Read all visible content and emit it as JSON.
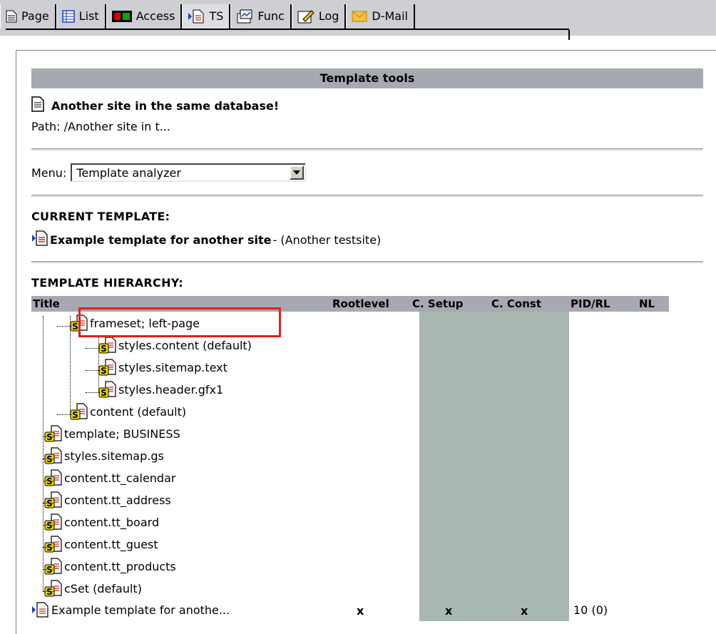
{
  "tabs": [
    {
      "label": "Page",
      "icon": "page-icon"
    },
    {
      "label": "List",
      "icon": "list-icon"
    },
    {
      "label": "Access",
      "icon": "access-icon"
    },
    {
      "label": "TS",
      "icon": "ts-template-icon"
    },
    {
      "label": "Func",
      "icon": "func-icon"
    },
    {
      "label": "Log",
      "icon": "log-icon"
    },
    {
      "label": "D-Mail",
      "icon": "mail-icon"
    }
  ],
  "header": {
    "title": "Template tools"
  },
  "page": {
    "title": "Another site in the same database!",
    "path": "Path: /Another site in t..."
  },
  "menu": {
    "label": "Menu:",
    "selected": "Template analyzer"
  },
  "current": {
    "heading": "CURRENT TEMPLATE:",
    "name": "Example template for another site",
    "suffix": " - (Another testsite)"
  },
  "hierarchy": {
    "heading": "TEMPLATE HIERARCHY:",
    "columns": {
      "title": "Title",
      "rootlevel": "Rootlevel",
      "setup": "C. Setup",
      "const": "C. Const",
      "pid": "PID/RL",
      "nl": "NL"
    },
    "rows": [
      {
        "name": "frameset; left-page",
        "level": 1
      },
      {
        "name": "styles.content (default)",
        "level": 2
      },
      {
        "name": "styles.sitemap.text",
        "level": 2
      },
      {
        "name": "styles.header.gfx1",
        "level": 2
      },
      {
        "name": "content (default)",
        "level": 1
      },
      {
        "name": "template; BUSINESS",
        "level": 0
      },
      {
        "name": "styles.sitemap.gs",
        "level": 0
      },
      {
        "name": "content.tt_calendar",
        "level": 0
      },
      {
        "name": "content.tt_address",
        "level": 0
      },
      {
        "name": "content.tt_board",
        "level": 0
      },
      {
        "name": "content.tt_guest",
        "level": 0
      },
      {
        "name": "content.tt_products",
        "level": 0
      },
      {
        "name": "cSet (default)",
        "level": 0
      }
    ],
    "last": {
      "name": "Example template for anothe...",
      "rootlevel": "x",
      "setup": "x",
      "const": "x",
      "pid": "10 (0)"
    }
  }
}
